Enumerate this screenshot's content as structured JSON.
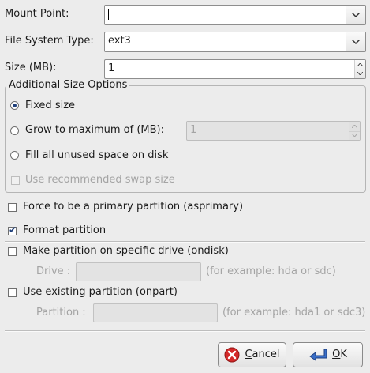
{
  "mount_point": {
    "label": "Mount Point:",
    "value": ""
  },
  "fs_type": {
    "label": "File System Type:",
    "value": "ext3"
  },
  "size": {
    "label": "Size (MB):",
    "value": "1"
  },
  "size_options": {
    "legend": "Additional Size Options",
    "fixed": {
      "label": "Fixed size",
      "selected": true
    },
    "grow": {
      "label": "Grow to maximum of (MB):",
      "value": "1",
      "selected": false
    },
    "fill": {
      "label": "Fill all unused space on disk",
      "selected": false
    },
    "swap": {
      "label": "Use recommended swap size",
      "checked": false,
      "enabled": false
    }
  },
  "primary": {
    "label": "Force to be a primary partition (asprimary)",
    "checked": false
  },
  "format": {
    "label": "Format partition",
    "checked": true
  },
  "ondisk": {
    "label": "Make partition on specific drive (ondisk)",
    "checked": false,
    "drive_label": "Drive :",
    "drive_value": "",
    "hint": "(for example: hda or sdc)"
  },
  "onpart": {
    "label": "Use existing partition (onpart)",
    "checked": false,
    "partition_label": "Partition :",
    "partition_value": "",
    "hint": "(for example: hda1 or sdc3)"
  },
  "buttons": {
    "cancel": {
      "label_u": "C",
      "label_rest": "ancel",
      "icon": "cancel-icon"
    },
    "ok": {
      "label_u": "O",
      "label_rest": "K",
      "icon": "ok-icon"
    }
  },
  "colors": {
    "accent": "#1f3f7a",
    "cancel_icon": "#d42a2a",
    "ok_arrow": "#3a6fc8"
  }
}
